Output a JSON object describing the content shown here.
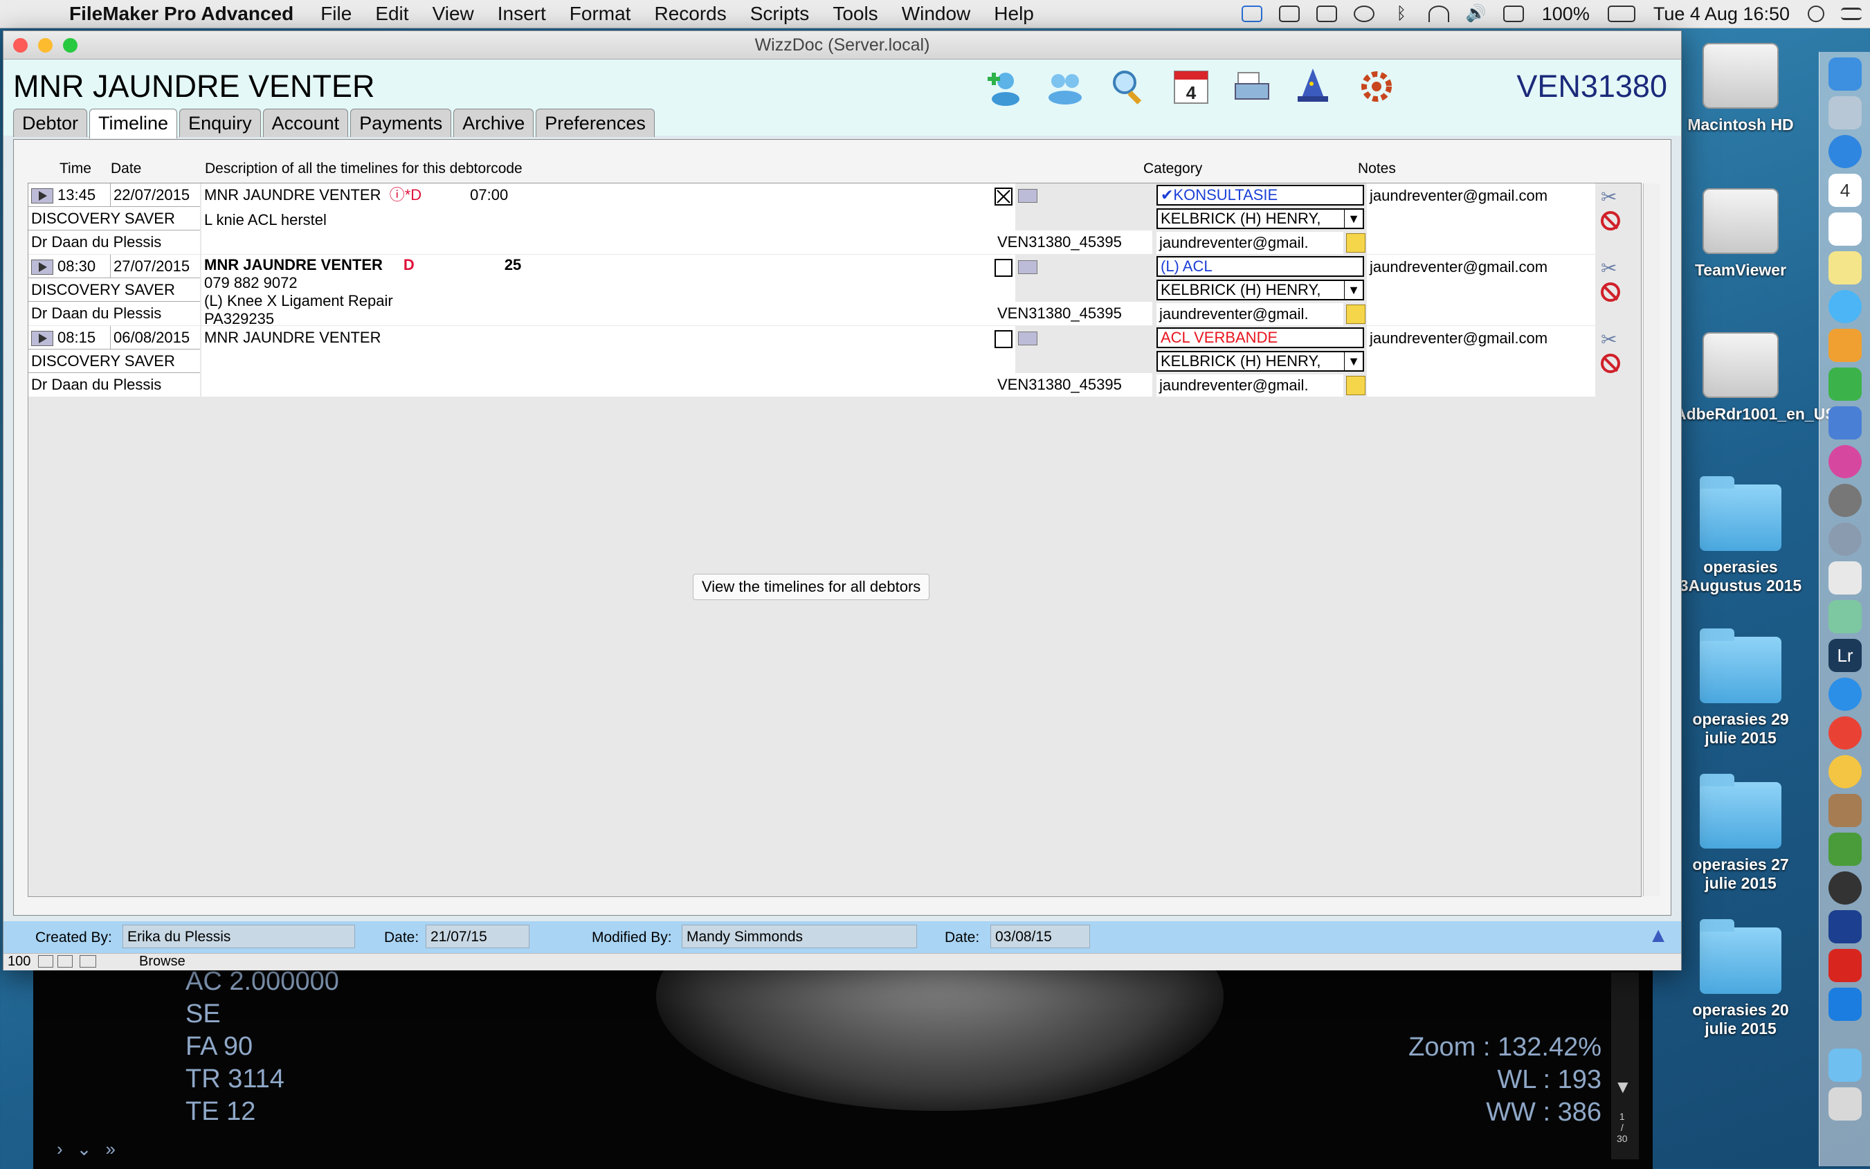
{
  "menubar": {
    "app_name": "FileMaker Pro Advanced",
    "items": [
      "File",
      "Edit",
      "View",
      "Insert",
      "Format",
      "Records",
      "Scripts",
      "Tools",
      "Window",
      "Help"
    ],
    "battery": "100%",
    "clock": "Tue 4 Aug  16:50"
  },
  "window": {
    "title": "WizzDoc (Server.local)",
    "patient_name": "MNR JAUNDRE VENTER",
    "debtor_code": "VEN31380",
    "tabs": [
      "Debtor",
      "Timeline",
      "Enquiry",
      "Account",
      "Payments",
      "Archive",
      "Preferences"
    ],
    "active_tab": "Timeline",
    "toolbar_icons": [
      "add-person-icon",
      "group-icon",
      "search-icon",
      "calendar-icon",
      "print-icon",
      "wizard-icon",
      "settings-icon"
    ],
    "calendar_day": "4"
  },
  "columns": {
    "time": "Time",
    "date": "Date",
    "description": "Description of all the timelines for this debtorcode",
    "category": "Category",
    "notes": "Notes"
  },
  "timeline": [
    {
      "time": "13:45",
      "date": "22/07/2015",
      "medical_aid": "DISCOVERY  SAVER",
      "doctor": "Dr Daan du Plessis",
      "desc_line1": "MNR JAUNDRE VENTER",
      "desc_flag": "ⓘ*D",
      "desc_extra": "07:00",
      "desc_line2": "L knie ACL herstel",
      "desc_line3": "",
      "desc_line4": "",
      "checked": true,
      "ref": "VEN31380_45395",
      "category": "✔KONSULTASIE",
      "category_color": "#1a3fd6",
      "provider": "KELBRICK (H) HENRY,",
      "email_short": "jaundreventer@gmail.",
      "note": "jaundreventer@gmail.com",
      "bold_title": false
    },
    {
      "time": "08:30",
      "date": "27/07/2015",
      "medical_aid": "DISCOVERY  SAVER",
      "doctor": "Dr Daan du Plessis",
      "desc_line1": "MNR JAUNDRE VENTER",
      "desc_flag": "D",
      "desc_extra": "25",
      "desc_line2": "079 882 9072",
      "desc_line3": "(L) Knee X Ligament Repair",
      "desc_line4": "PA329235",
      "checked": false,
      "ref": "VEN31380_45395",
      "category": "(L)  ACL",
      "category_color": "#1a3fd6",
      "provider": "KELBRICK (H) HENRY,",
      "email_short": "jaundreventer@gmail.",
      "note": "jaundreventer@gmail.com",
      "bold_title": true
    },
    {
      "time": "08:15",
      "date": "06/08/2015",
      "medical_aid": "DISCOVERY  SAVER",
      "doctor": "Dr Daan du Plessis",
      "desc_line1": "MNR JAUNDRE VENTER",
      "desc_flag": "",
      "desc_extra": "",
      "desc_line2": "",
      "desc_line3": "",
      "desc_line4": "",
      "checked": false,
      "ref": "VEN31380_45395",
      "category": "ACL VERBANDE",
      "category_color": "#e8141e",
      "provider": "KELBRICK (H) HENRY,",
      "email_short": "jaundreventer@gmail.",
      "note": "jaundreventer@gmail.com",
      "bold_title": false
    }
  ],
  "view_all_button": "View the timelines for all debtors",
  "footer": {
    "created_by_label": "Created By:",
    "created_by": "Erika du Plessis",
    "created_date_label": "Date:",
    "created_date": "21/07/15",
    "modified_by_label": "Modified By:",
    "modified_by": "Mandy Simmonds",
    "modified_date_label": "Date:",
    "modified_date": "03/08/15"
  },
  "statusbar": {
    "zoom": "100",
    "mode": "Browse"
  },
  "desktop": {
    "items": [
      "Macintosh HD",
      "TeamViewer",
      "AdbeRdr1001_en_US",
      "operasies 3Augustus 2015",
      "operasies 29 julie 2015",
      "operasies 27 julie 2015",
      "operasies 20 julie 2015"
    ]
  },
  "viewer": {
    "left_lines": [
      "AC 2.000000",
      "SE",
      "FA 90",
      "TR 3114",
      "TE 12"
    ],
    "right_lines": [
      "Zoom : 132.42%",
      "WL : 193",
      "WW : 386"
    ],
    "page_top": "1",
    "page_sep": "/",
    "page_total": "30"
  }
}
